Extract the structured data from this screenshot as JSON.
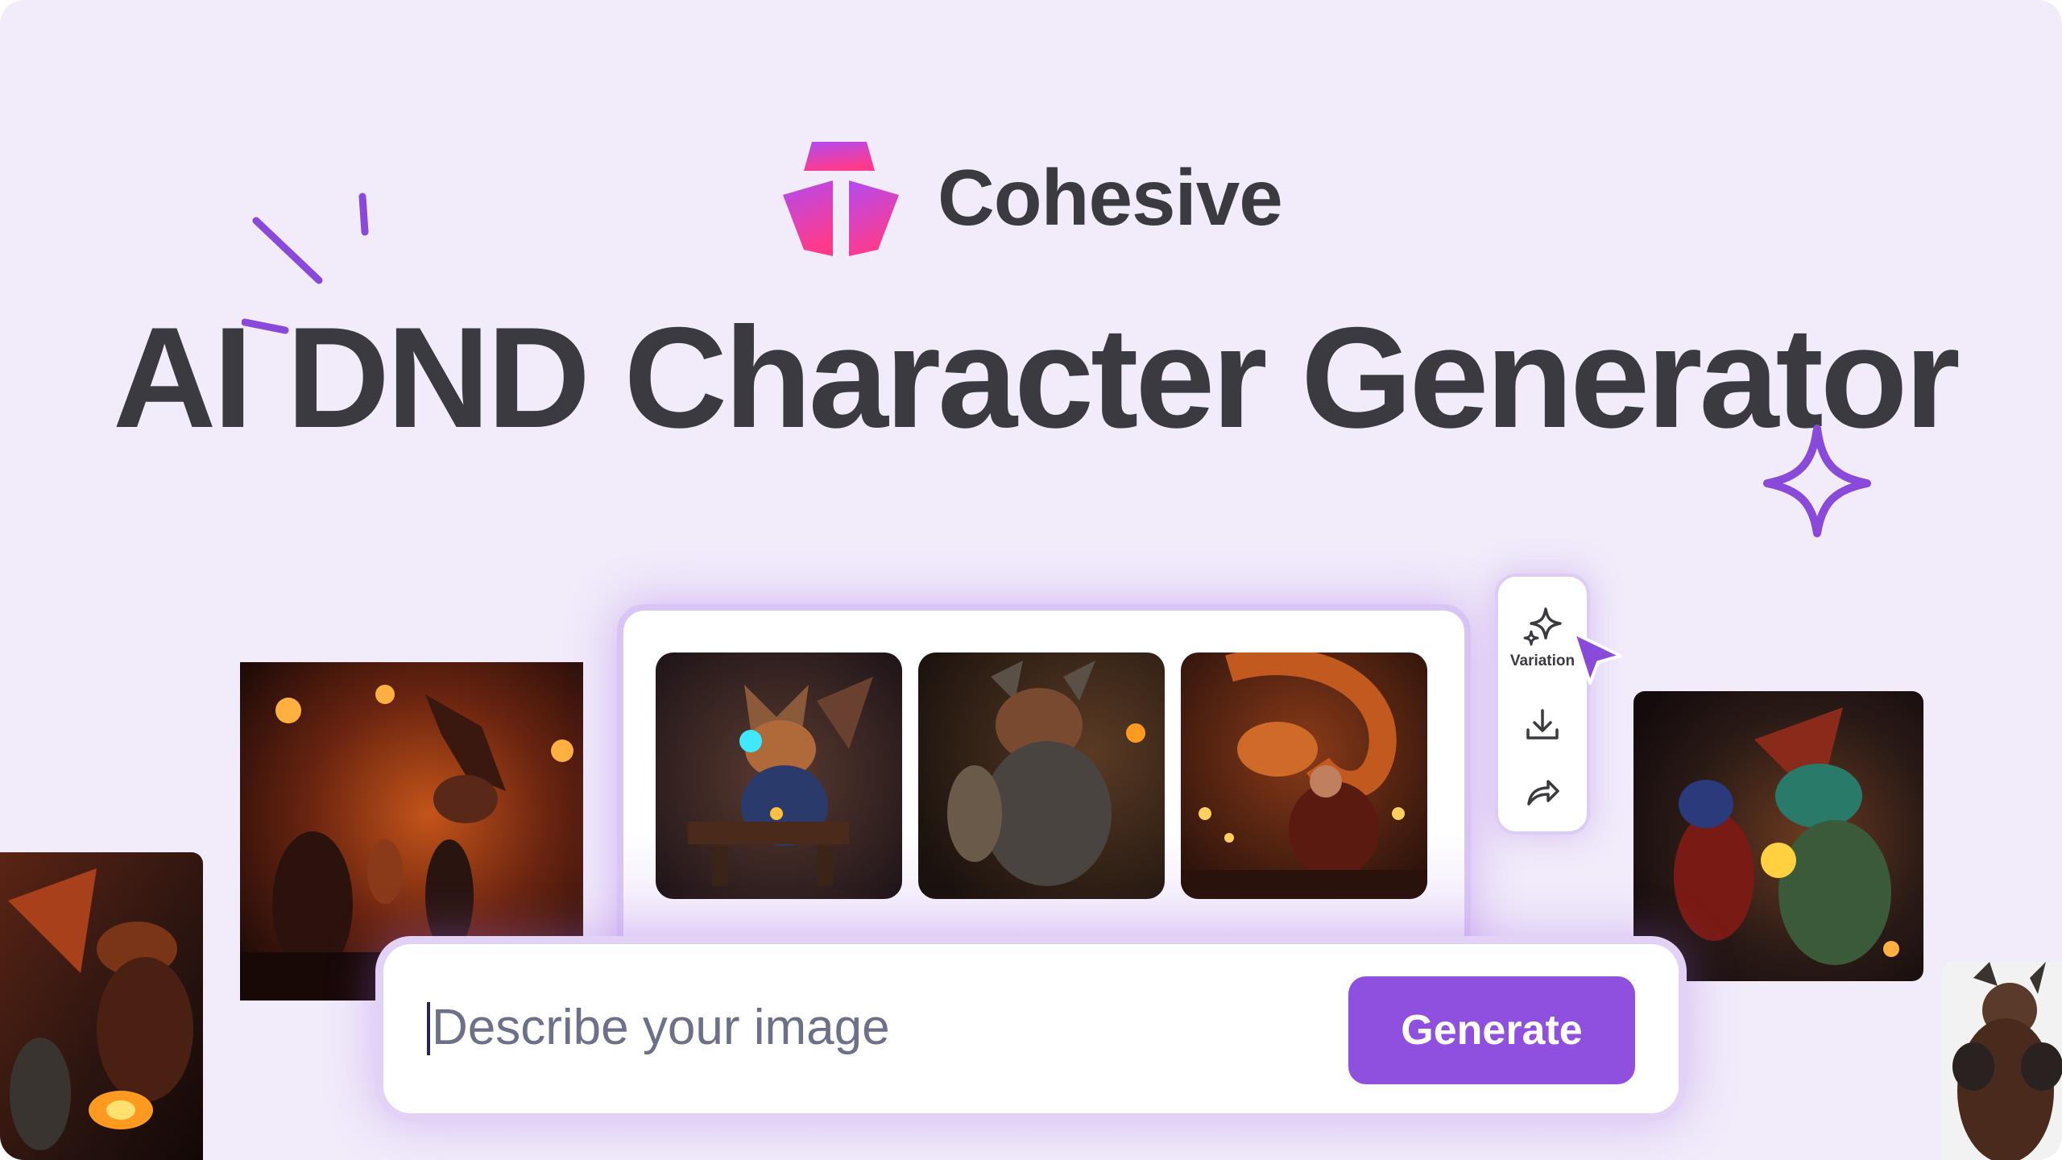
{
  "brand": {
    "name": "Cohesive",
    "logo_icon": "cohesive-logo-icon"
  },
  "headline": "AI DND Character Generator",
  "toolbar": {
    "variation_label": "Variation",
    "variation_icon": "sparkle-icon",
    "download_icon": "download-icon",
    "share_icon": "share-arrow-icon"
  },
  "prompt": {
    "placeholder": "Describe your image",
    "value": ""
  },
  "generate_button": {
    "label": "Generate"
  },
  "colors": {
    "background": "#f1ebfa",
    "accent": "#9050df",
    "text": "#3b3a40",
    "logo_gradient_top": "#b24bf2",
    "logo_gradient_bottom": "#ff3a8c"
  }
}
